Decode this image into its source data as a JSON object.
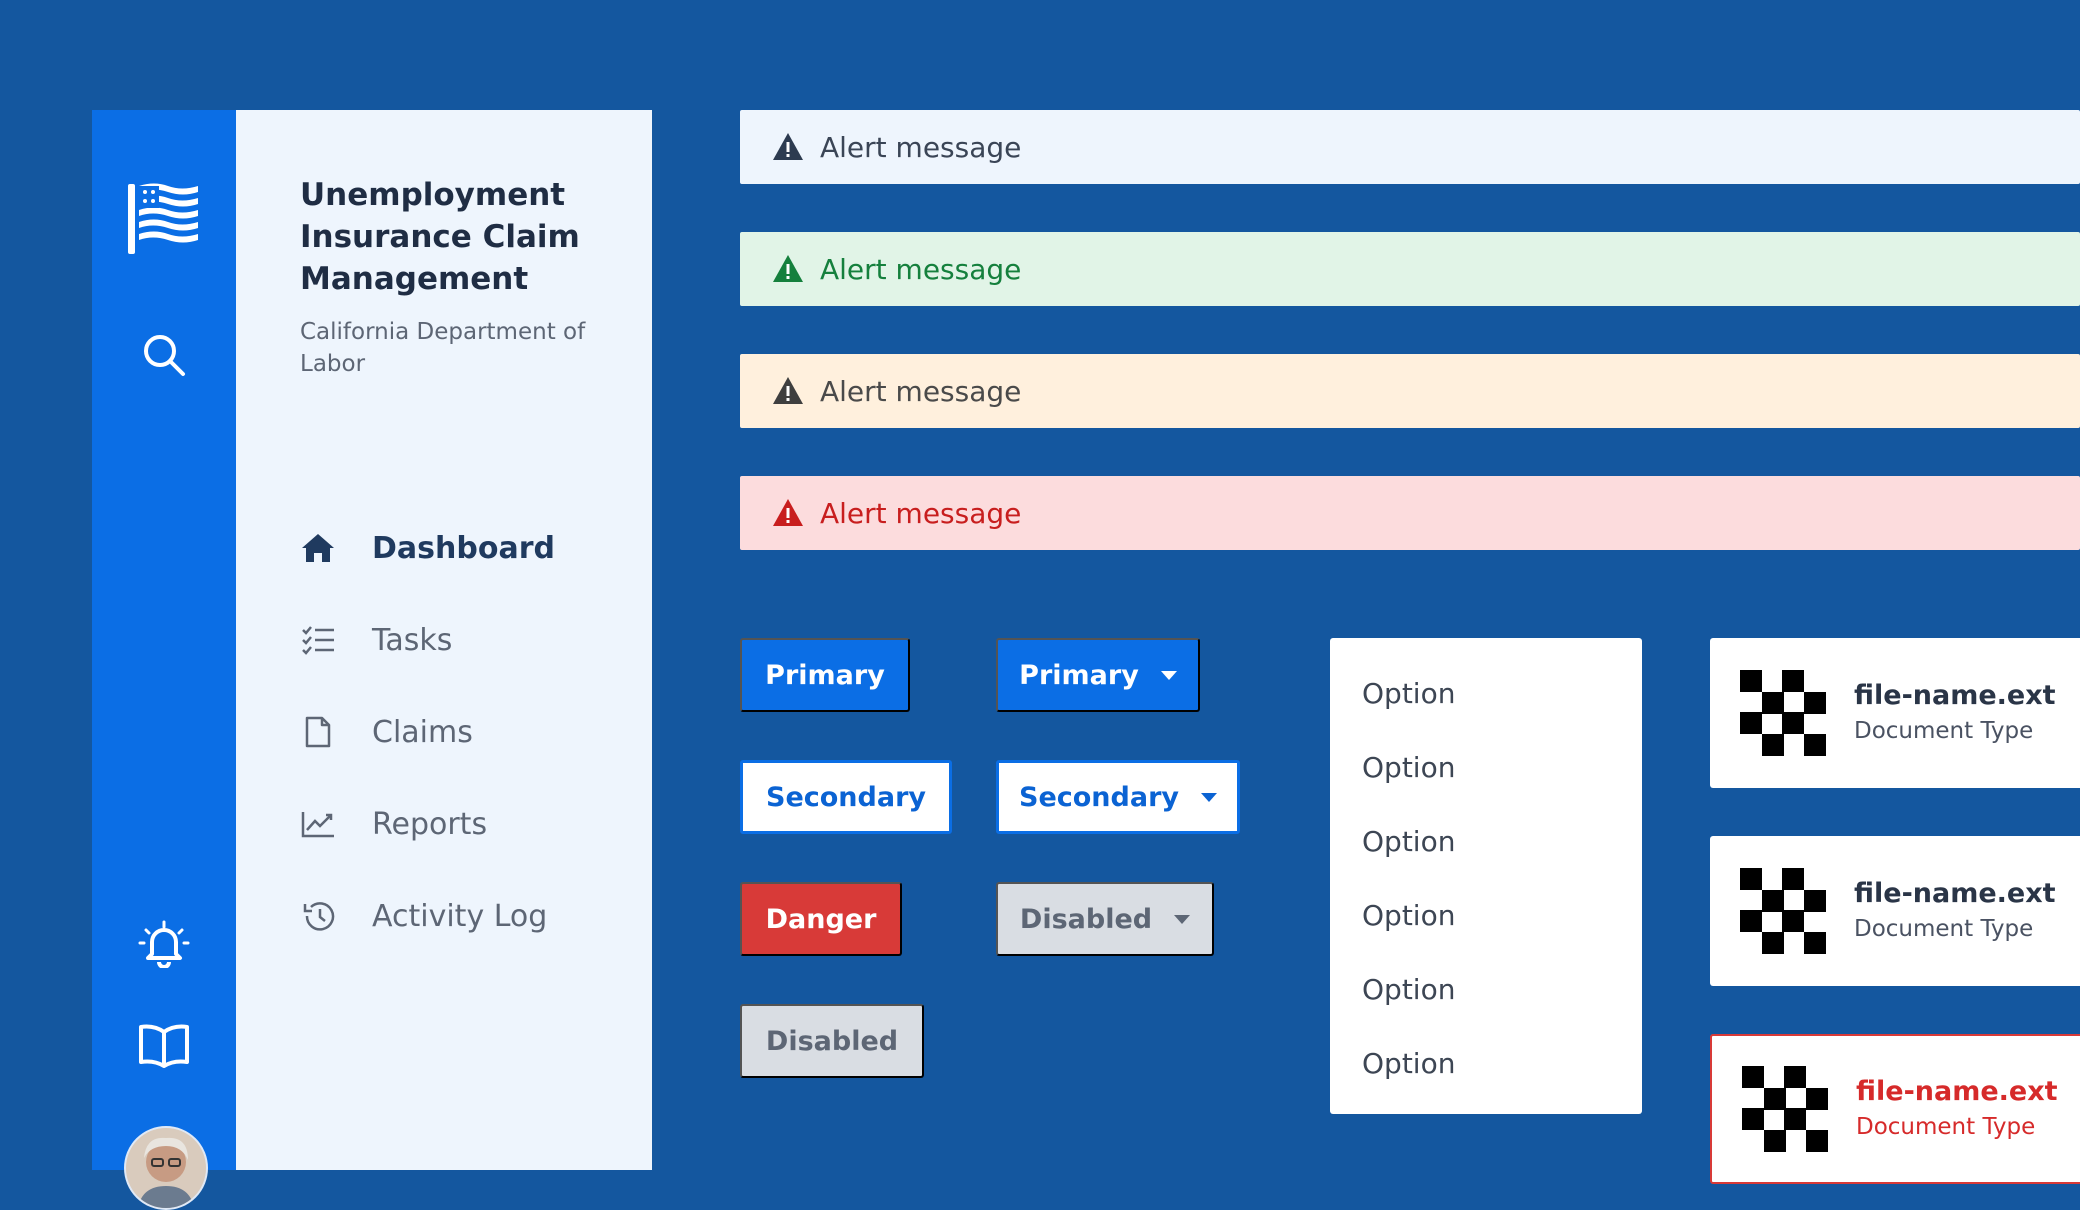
{
  "app": {
    "title": "Unemployment Insurance Claim Management",
    "subtitle": "California Department of Labor"
  },
  "rail": {
    "icons": [
      "flag-icon",
      "search-icon",
      "bell-icon",
      "book-icon",
      "avatar"
    ]
  },
  "nav": {
    "items": [
      {
        "label": "Dashboard",
        "icon": "home-icon",
        "active": true
      },
      {
        "label": "Tasks",
        "icon": "checklist-icon",
        "active": false
      },
      {
        "label": "Claims",
        "icon": "document-icon",
        "active": false
      },
      {
        "label": "Reports",
        "icon": "chart-line-icon",
        "active": false
      },
      {
        "label": "Activity Log",
        "icon": "history-icon",
        "active": false
      }
    ]
  },
  "alerts": [
    {
      "type": "info",
      "message": "Alert message",
      "color": "#eef5fd"
    },
    {
      "type": "success",
      "message": "Alert message",
      "color": "#e1f4e7"
    },
    {
      "type": "warning",
      "message": "Alert message",
      "color": "#fff0dd"
    },
    {
      "type": "error",
      "message": "Alert message",
      "color": "#fcdcdd"
    }
  ],
  "buttons": {
    "primary": "Primary",
    "primary_dropdown": "Primary",
    "secondary": "Secondary",
    "secondary_dropdown": "Secondary",
    "danger": "Danger",
    "disabled_dropdown": "Disabled",
    "disabled": "Disabled"
  },
  "menu": {
    "options": [
      "Option",
      "Option",
      "Option",
      "Option",
      "Option",
      "Option"
    ]
  },
  "files": [
    {
      "name": "file-name.ext",
      "type": "Document Type",
      "state": "default"
    },
    {
      "name": "file-name.ext",
      "type": "Document Type",
      "state": "default"
    },
    {
      "name": "file-name.ext",
      "type": "Document Type",
      "state": "error"
    }
  ],
  "colors": {
    "background": "#14579f",
    "accent": "#0b6ee5",
    "danger": "#d83a38",
    "success": "#15803d",
    "panel": "#eef5fd"
  }
}
